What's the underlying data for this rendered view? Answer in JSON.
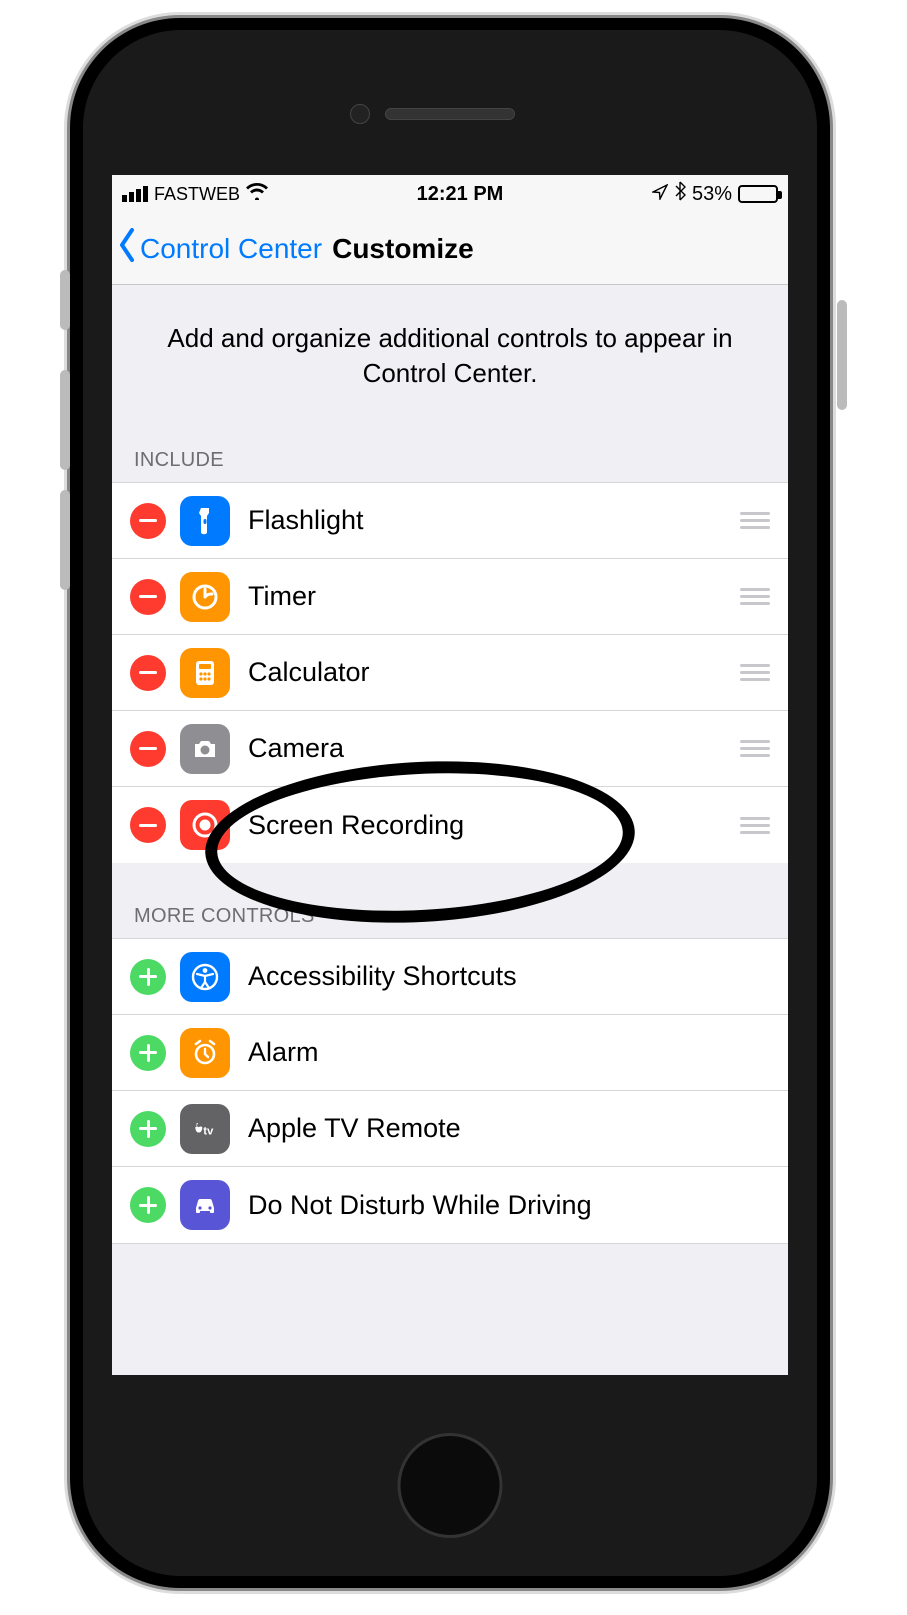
{
  "status": {
    "carrier": "FASTWEB",
    "time": "12:21 PM",
    "battery_percent": "53%",
    "battery_level_pct": 53
  },
  "nav": {
    "back_label": "Control Center",
    "title": "Customize"
  },
  "description": "Add and organize additional controls to appear in Control Center.",
  "sections": {
    "include_label": "INCLUDE",
    "more_label": "MORE CONTROLS"
  },
  "include": [
    {
      "label": "Flashlight",
      "icon": "flashlight-icon",
      "bg": "ic-blue"
    },
    {
      "label": "Timer",
      "icon": "timer-icon",
      "bg": "ic-orange"
    },
    {
      "label": "Calculator",
      "icon": "calculator-icon",
      "bg": "ic-orange"
    },
    {
      "label": "Camera",
      "icon": "camera-icon",
      "bg": "ic-gray"
    },
    {
      "label": "Screen Recording",
      "icon": "screen-recording-icon",
      "bg": "ic-red"
    }
  ],
  "more": [
    {
      "label": "Accessibility Shortcuts",
      "icon": "accessibility-icon",
      "bg": "ic-blue"
    },
    {
      "label": "Alarm",
      "icon": "alarm-icon",
      "bg": "ic-orange"
    },
    {
      "label": "Apple TV Remote",
      "icon": "apple-tv-icon",
      "bg": "ic-darkgray"
    },
    {
      "label": "Do Not Disturb While Driving",
      "icon": "car-icon",
      "bg": "ic-indigo"
    }
  ]
}
